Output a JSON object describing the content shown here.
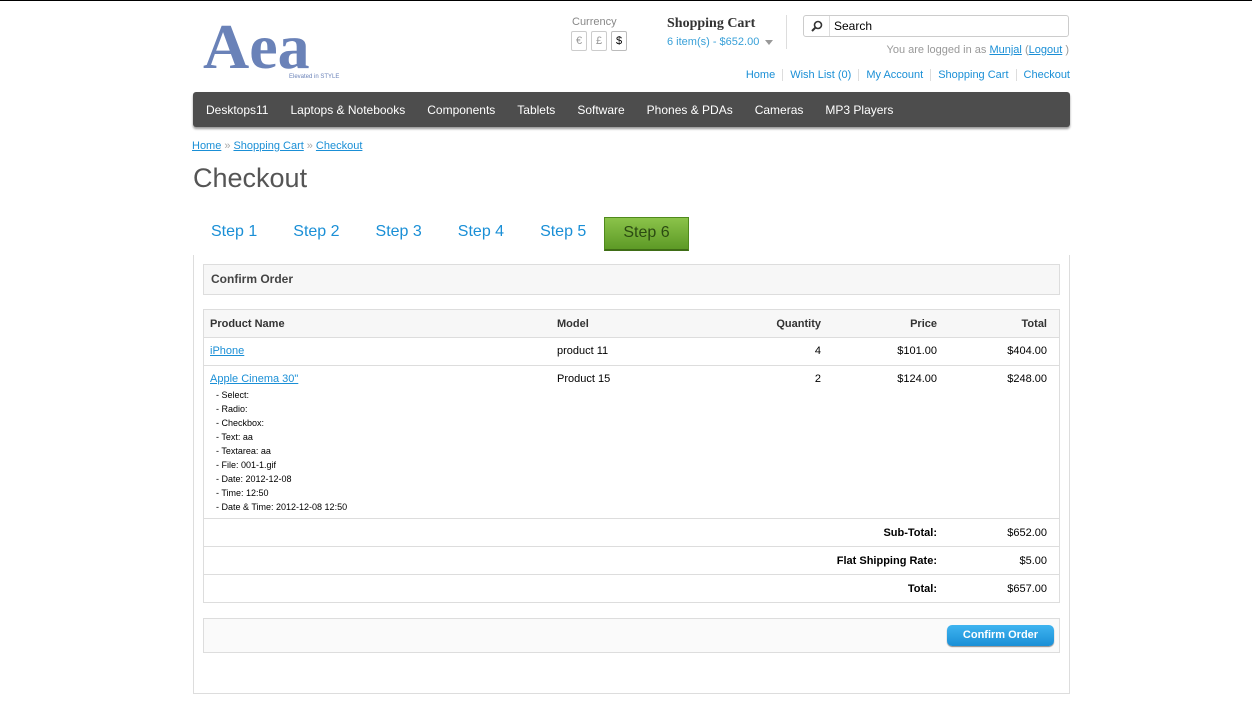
{
  "logo": {
    "text": "Aea",
    "tagline": "Elevated in STYLE"
  },
  "currency": {
    "label": "Currency",
    "options": [
      "€",
      "£",
      "$"
    ],
    "selected": "$"
  },
  "cart": {
    "title": "Shopping Cart",
    "summary": "6 item(s) - $652.00"
  },
  "search": {
    "placeholder": "Search"
  },
  "welcome": {
    "prefix": "You are logged in as",
    "user": "Munjal",
    "open": "(",
    "logout": "Logout",
    "close": ")"
  },
  "toplinks": [
    "Home",
    "Wish List (0)",
    "My Account",
    "Shopping Cart",
    "Checkout"
  ],
  "menu": [
    "Desktops11",
    "Laptops & Notebooks",
    "Components",
    "Tablets",
    "Software",
    "Phones & PDAs",
    "Cameras",
    "MP3 Players"
  ],
  "breadcrumb": [
    "Home",
    "Shopping Cart",
    "Checkout"
  ],
  "breadcrumb_sep": "»",
  "page_title": "Checkout",
  "steps": [
    "Step 1",
    "Step 2",
    "Step 3",
    "Step 4",
    "Step 5",
    "Step 6"
  ],
  "active_step": 6,
  "confirm_heading": "Confirm Order",
  "table": {
    "headers": {
      "name": "Product Name",
      "model": "Model",
      "qty": "Quantity",
      "price": "Price",
      "total": "Total"
    },
    "items": [
      {
        "name": "iPhone",
        "model": "product 11",
        "qty": "4",
        "price": "$101.00",
        "total": "$404.00",
        "options": []
      },
      {
        "name": "Apple Cinema 30\"",
        "model": "Product 15",
        "qty": "2",
        "price": "$124.00",
        "total": "$248.00",
        "options": [
          "- Select:",
          "- Radio:",
          "- Checkbox:",
          "- Text: aa",
          "- Textarea: aa",
          "- File: 001-1.gif",
          "- Date: 2012-12-08",
          "- Time: 12:50",
          "- Date & Time: 2012-12-08 12:50"
        ]
      }
    ],
    "totals": [
      {
        "label": "Sub-Total:",
        "value": "$652.00"
      },
      {
        "label": "Flat Shipping Rate:",
        "value": "$5.00"
      },
      {
        "label": "Total:",
        "value": "$657.00"
      }
    ]
  },
  "confirm_button": "Confirm Order",
  "colors": {
    "link": "#1a8fd6",
    "menu_bg": "#4d4d4d",
    "active_step": "#8bc34a",
    "button": "#1a8fd6"
  }
}
